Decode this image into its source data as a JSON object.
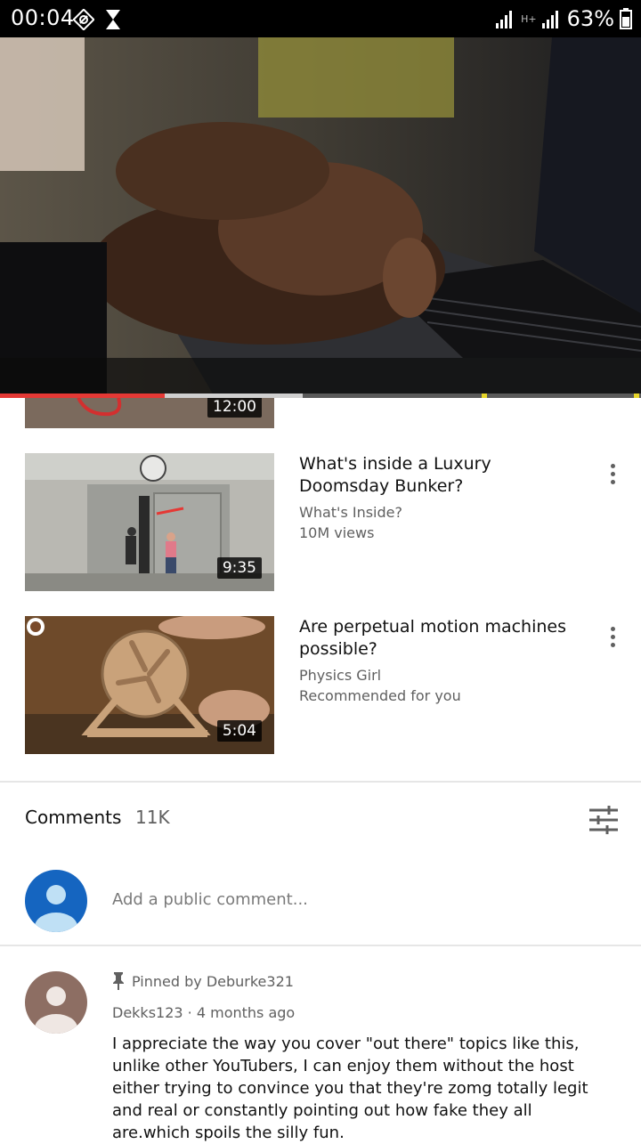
{
  "status_bar": {
    "time": "00:04",
    "network_label": "H+",
    "battery": "63%"
  },
  "player": {
    "progress_fraction": 0.257
  },
  "partial_video": {
    "duration": "12:00"
  },
  "videos": [
    {
      "title": "What's inside a Luxury Doomsday Bunker?",
      "channel": "What's Inside?",
      "meta": "10M views",
      "duration": "9:35"
    },
    {
      "title": "Are perpetual motion machines possible?",
      "channel": "Physics Girl",
      "meta": "Recommended for you",
      "duration": "5:04"
    }
  ],
  "comments": {
    "header": "Comments",
    "count": "11K",
    "add_placeholder": "Add a public comment...",
    "pinned_label": "Pinned by Deburke321",
    "first": {
      "author": "Dekks123",
      "time": "4 months ago",
      "text": "I appreciate the way you cover \"out there\" topics like this, unlike other YouTubers, I can enjoy them without the host either trying to convince you that they're zomg totally legit and real or constantly pointing out how fake they all are.which spoils the silly fun."
    }
  },
  "colors": {
    "accent_red": "#e53935",
    "avatar_blue": "#1565c0",
    "avatar_brown": "#8d6e63"
  }
}
